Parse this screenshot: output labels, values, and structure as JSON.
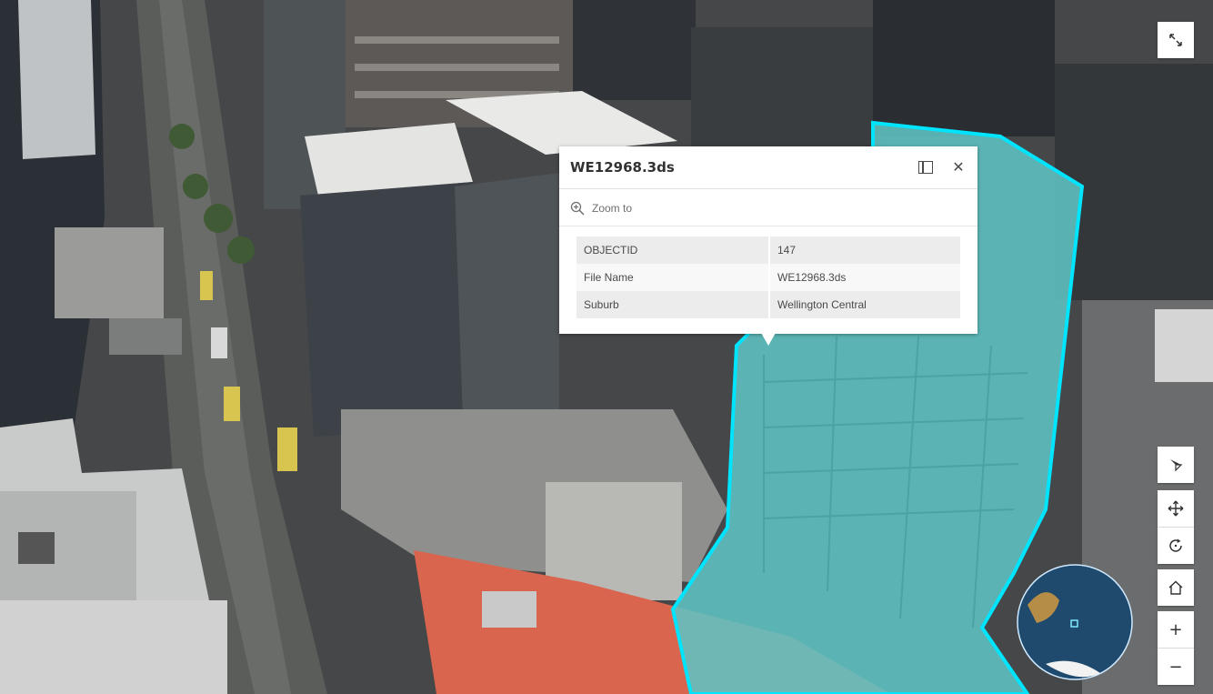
{
  "popup": {
    "title": "WE12968.3ds",
    "zoom_to_label": "Zoom to",
    "attributes": [
      {
        "key": "OBJECTID",
        "value": "147"
      },
      {
        "key": "File Name",
        "value": "WE12968.3ds"
      },
      {
        "key": "Suburb",
        "value": "Wellington Central"
      }
    ]
  },
  "controls": {
    "fullscreen": "fullscreen-icon",
    "compass": "compass-icon",
    "pan": "pan-icon",
    "rotate": "rotate-icon",
    "home": "home-icon",
    "zoom_in": "+",
    "zoom_out": "−"
  },
  "colors": {
    "highlight_fill": "#5fc3c3",
    "highlight_outline": "#00e5ff",
    "roof_red": "#d9654f"
  }
}
